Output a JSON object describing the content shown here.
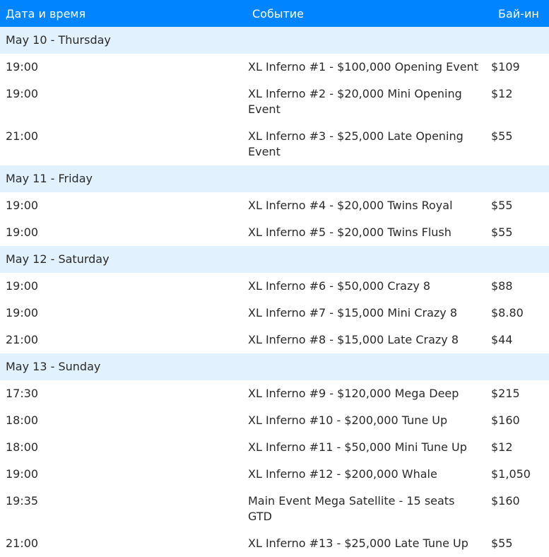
{
  "header": {
    "time": "Дата и время",
    "event": "Событие",
    "buyin": "Бай-ин"
  },
  "days": [
    {
      "label": "May 10 - Thursday",
      "rows": [
        {
          "time": "19:00",
          "event": "XL Inferno #1 - $100,000 Opening Event",
          "buyin": "$109"
        },
        {
          "time": "19:00",
          "event": "XL Inferno #2 - $20,000 Mini Opening Event",
          "buyin": "$12"
        },
        {
          "time": "21:00",
          "event": "XL Inferno #3 - $25,000 Late Opening Event",
          "buyin": "$55"
        }
      ]
    },
    {
      "label": "May 11 - Friday",
      "rows": [
        {
          "time": "19:00",
          "event": "XL Inferno #4 - $20,000 Twins Royal",
          "buyin": "$55"
        },
        {
          "time": "19:00",
          "event": "XL Inferno #5 - $20,000 Twins Flush",
          "buyin": "$55"
        }
      ]
    },
    {
      "label": "May 12 - Saturday",
      "rows": [
        {
          "time": "19:00",
          "event": "XL Inferno #6 - $50,000 Crazy 8",
          "buyin": "$88"
        },
        {
          "time": "19:00",
          "event": "XL Inferno #7 - $15,000 Mini Crazy 8",
          "buyin": "$8.80"
        },
        {
          "time": "21:00",
          "event": "XL Inferno #8 - $15,000 Late Crazy 8",
          "buyin": "$44"
        }
      ]
    },
    {
      "label": "May 13 - Sunday",
      "rows": [
        {
          "time": "17:30",
          "event": "XL Inferno #9 - $120,000 Mega Deep",
          "buyin": "$215"
        },
        {
          "time": "18:00",
          "event": "XL Inferno #10 - $200,000 Tune Up",
          "buyin": "$160"
        },
        {
          "time": "18:00",
          "event": "XL Inferno #11 - $50,000 Mini Tune Up",
          "buyin": "$12"
        },
        {
          "time": "19:00",
          "event": "XL Inferno #12 - $200,000 Whale",
          "buyin": "$1,050"
        },
        {
          "time": "19:35",
          "event": "Main Event Mega Satellite - 15 seats GTD",
          "buyin": "$160"
        },
        {
          "time": "21:00",
          "event": "XL Inferno #13 - $25,000 Late Tune Up",
          "buyin": "$55"
        }
      ]
    }
  ]
}
